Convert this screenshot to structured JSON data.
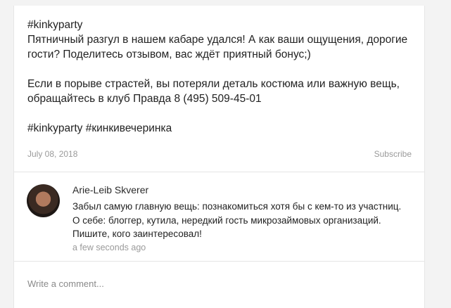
{
  "post": {
    "lines": [
      "#kinkyparty",
      "Пятничный разгул в нашем кабаре удался! А как ваши ощущения, дорогие",
      "гости? Поделитесь отзывом, вас ждёт приятный бонус;)",
      "",
      "Если в порыве страстей, вы потеряли деталь костюма или важную вещь,",
      "обращайтесь в клуб Правда 8 (495) 509-45-01",
      "",
      "#kinkyparty #кинкивечеринка"
    ],
    "date": "July 08, 2018",
    "subscribe_label": "Subscribe"
  },
  "comment": {
    "author": "Arie-Leib Skverer",
    "lines": [
      "Забыл самую главную вещь: познакомиться хотя бы с кем-то из участниц.",
      "О себе: блоггер, кутила, нередкий гость микрозаймовых организаций.",
      "Пишите, кого заинтересовал!"
    ],
    "time": "a few seconds ago"
  },
  "composer": {
    "placeholder": "Write a comment..."
  },
  "colors": {
    "background": "#f3f3f3",
    "card": "#ffffff",
    "text": "#222222",
    "muted": "#9a9a9a",
    "divider": "#e5e5e5"
  }
}
